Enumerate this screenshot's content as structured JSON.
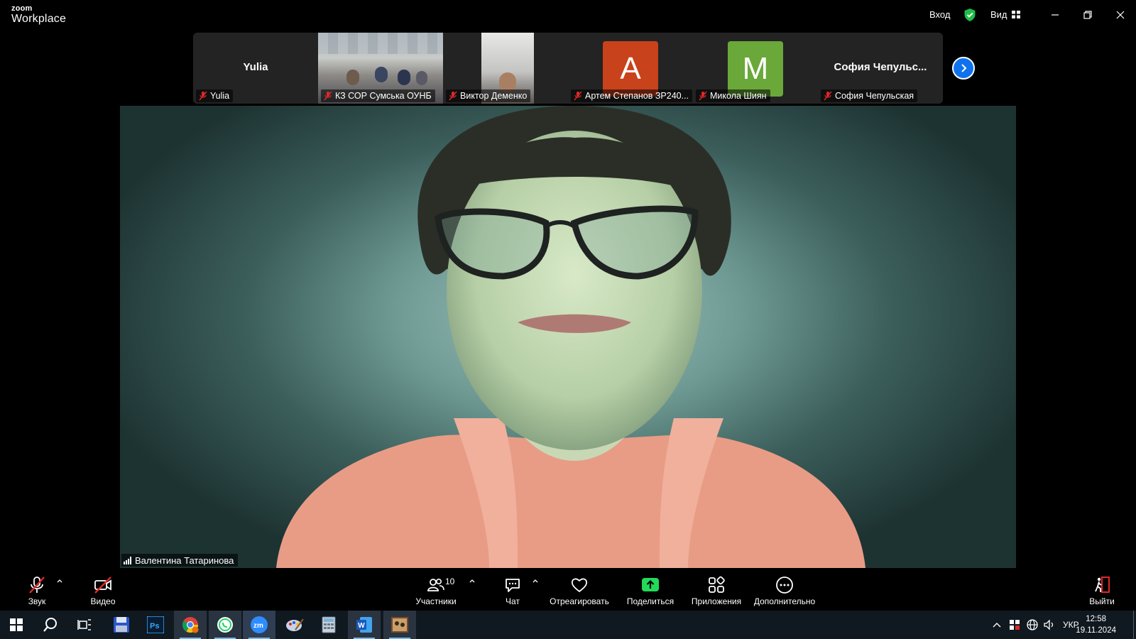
{
  "app": {
    "logo_small": "zoom",
    "logo_big": "Workplace",
    "signin_label": "Вход",
    "view_label": "Вид"
  },
  "filmstrip": {
    "tiles": [
      {
        "kind": "name",
        "big_name": "Yulia",
        "label": "Yulia"
      },
      {
        "kind": "video",
        "label": "КЗ СОР Сумська ОУНБ"
      },
      {
        "kind": "video",
        "label": "Виктор Деменко"
      },
      {
        "kind": "avatar",
        "letter": "A",
        "avatar_color": "#c8421b",
        "label": "Артем Степанов ЗР240..."
      },
      {
        "kind": "avatar",
        "letter": "M",
        "avatar_color": "#6aa83a",
        "label": "Микола Шиян"
      },
      {
        "kind": "name",
        "big_name": "София  Чепульс...",
        "label": "София Чепульская"
      }
    ]
  },
  "main_speaker": {
    "name": "Валентина Татаринова"
  },
  "toolbar": {
    "audio_label": "Звук",
    "video_label": "Видео",
    "participants_label": "Участники",
    "participants_count": "10",
    "chat_label": "Чат",
    "react_label": "Отреагировать",
    "share_label": "Поделиться",
    "apps_label": "Приложения",
    "more_label": "Дополнительно",
    "leave_label": "Выйти"
  },
  "taskbar": {
    "language": "УКР",
    "time": "12:58",
    "date": "19.11.2024"
  },
  "colors": {
    "accent_blue": "#0e72ed",
    "muted_red": "#e02828",
    "share_green": "#23d959",
    "shield_green": "#1fbd4a"
  }
}
